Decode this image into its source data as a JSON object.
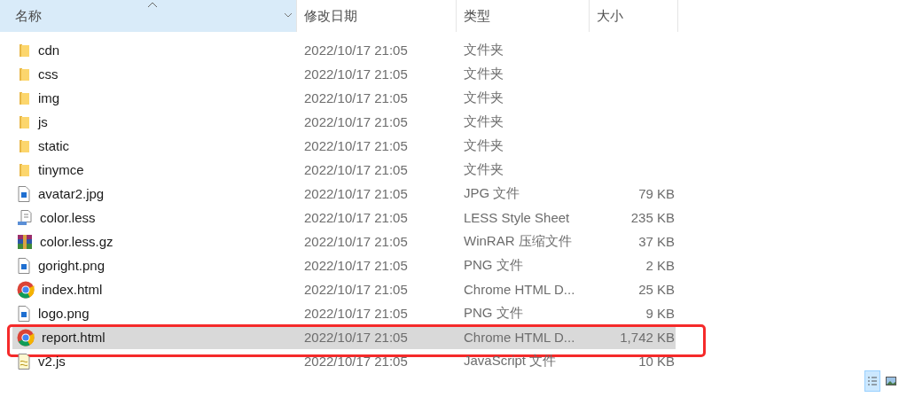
{
  "columns": [
    {
      "label": "名称",
      "sorted": true,
      "hovered": true
    },
    {
      "label": "修改日期",
      "sorted": false,
      "hovered": false
    },
    {
      "label": "类型",
      "sorted": false,
      "hovered": false
    },
    {
      "label": "大小",
      "sorted": false,
      "hovered": false
    }
  ],
  "rows": [
    {
      "kind": "folder",
      "name": "cdn",
      "modified": "2022/10/17 21:05",
      "type": "文件夹",
      "selected": false,
      "highlighted": false
    },
    {
      "kind": "folder",
      "name": "css",
      "modified": "2022/10/17 21:05",
      "type": "文件夹",
      "selected": false,
      "highlighted": false
    },
    {
      "kind": "folder",
      "name": "img",
      "modified": "2022/10/17 21:05",
      "type": "文件夹",
      "selected": false,
      "highlighted": false
    },
    {
      "kind": "folder",
      "name": "js",
      "modified": "2022/10/17 21:05",
      "type": "文件夹",
      "selected": false,
      "highlighted": false
    },
    {
      "kind": "folder",
      "name": "static",
      "modified": "2022/10/17 21:05",
      "type": "文件夹",
      "selected": false,
      "highlighted": false
    },
    {
      "kind": "folder",
      "name": "tinymce",
      "modified": "2022/10/17 21:05",
      "type": "文件夹",
      "selected": false,
      "highlighted": false
    },
    {
      "kind": "image",
      "name": "avatar2.jpg",
      "modified": "2022/10/17 21:05",
      "type": "JPG 文件",
      "size": "79 KB",
      "selected": false,
      "highlighted": false
    },
    {
      "kind": "stylesheet",
      "name": "color.less",
      "modified": "2022/10/17 21:05",
      "type": "LESS Style Sheet",
      "size": "235 KB",
      "selected": false,
      "highlighted": false
    },
    {
      "kind": "archive",
      "name": "color.less.gz",
      "modified": "2022/10/17 21:05",
      "type": "WinRAR 压缩文件",
      "size": "37 KB",
      "selected": false,
      "highlighted": false
    },
    {
      "kind": "image",
      "name": "goright.png",
      "modified": "2022/10/17 21:05",
      "type": "PNG 文件",
      "size": "2 KB",
      "selected": false,
      "highlighted": false
    },
    {
      "kind": "browser",
      "name": "index.html",
      "modified": "2022/10/17 21:05",
      "type": "Chrome HTML D...",
      "size": "25 KB",
      "selected": false,
      "highlighted": false
    },
    {
      "kind": "image",
      "name": "logo.png",
      "modified": "2022/10/17 21:05",
      "type": "PNG 文件",
      "size": "9 KB",
      "selected": false,
      "highlighted": false
    },
    {
      "kind": "browser",
      "name": "report.html",
      "modified": "2022/10/17 21:05",
      "type": "Chrome HTML D...",
      "size": "1,742 KB",
      "selected": true,
      "highlighted": true
    },
    {
      "kind": "script",
      "name": "v2.js",
      "modified": "2022/10/17 21:05",
      "type": "JavaScript 文件",
      "size": "10 KB",
      "selected": false,
      "highlighted": false
    }
  ],
  "view_buttons": [
    {
      "kind": "details",
      "selected": true
    },
    {
      "kind": "large_icons",
      "selected": false
    }
  ]
}
